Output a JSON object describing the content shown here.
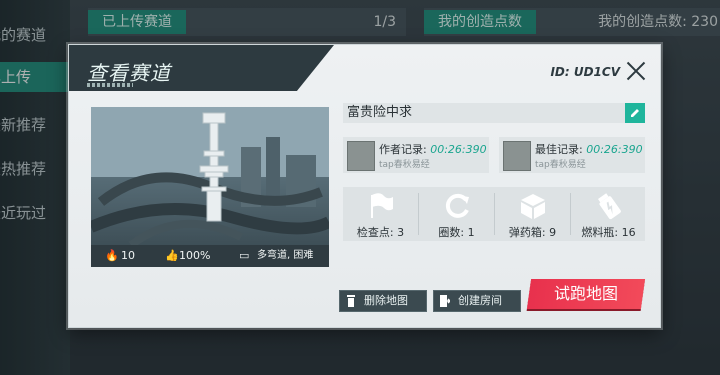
{
  "left_nav": {
    "items": [
      {
        "label": "我的赛道"
      },
      {
        "label": "已上传"
      },
      {
        "label": "最新推荐"
      },
      {
        "label": "最热推荐"
      },
      {
        "label": "最近玩过"
      }
    ]
  },
  "topbar": {
    "uploaded_tag": "已上传赛道",
    "uploaded_count": "1/3",
    "points_tag": "我的创造点数",
    "points_text": "我的创造点数: 230"
  },
  "modal": {
    "title": "查看赛道",
    "map_id": "ID: UD1CV",
    "map_name": "富贵险中求",
    "stats": {
      "heat": "10",
      "like": "100%",
      "tags": "多弯道, 困难"
    },
    "author_record": {
      "label": "作者记录:",
      "time": "00:26:390",
      "player": "tap春秋易经"
    },
    "best_record": {
      "label": "最佳记录:",
      "time": "00:26:390",
      "player": "tap春秋易经"
    },
    "features": [
      {
        "icon": "flag-icon",
        "label": "检查点: 3"
      },
      {
        "icon": "laps-icon",
        "label": "圈数: 1"
      },
      {
        "icon": "ammo-box-icon",
        "label": "弹药箱: 9"
      },
      {
        "icon": "fuel-bottle-icon",
        "label": "燃料瓶: 16"
      }
    ],
    "buttons": {
      "delete": "删除地图",
      "create_room": "创建房间",
      "try_run": "试跑地图"
    }
  },
  "colors": {
    "accent": "#1fb59c",
    "header": "#2d3a40",
    "try_button": "#e8314d"
  }
}
